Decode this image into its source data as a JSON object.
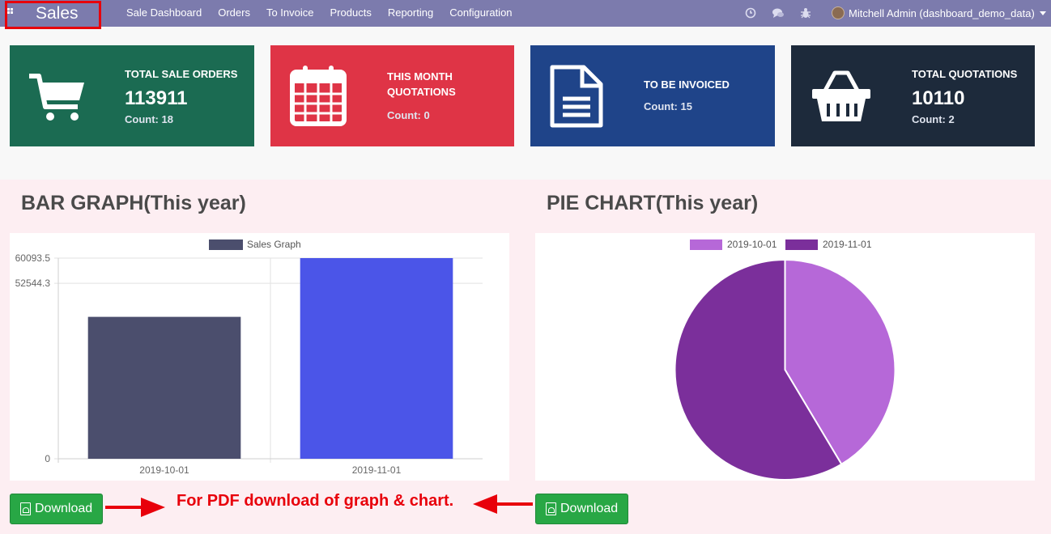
{
  "navbar": {
    "app_title": "Sales",
    "menu": [
      "Sale Dashboard",
      "Orders",
      "To Invoice",
      "Products",
      "Reporting",
      "Configuration"
    ],
    "user_name": "Mitchell Admin (dashboard_demo_data)",
    "icons": [
      "clock-icon",
      "chat-icon",
      "bug-icon"
    ]
  },
  "cards": [
    {
      "label": "TOTAL SALE ORDERS",
      "value": "113911",
      "count": "Count: 18",
      "color": "#1b6b52",
      "icon": "cart-icon"
    },
    {
      "label": "THIS MONTH QUOTATIONS",
      "count": "Count: 0",
      "color": "#df3446",
      "icon": "calendar-icon"
    },
    {
      "label": "TO BE INVOICED",
      "count": "Count: 15",
      "color": "#1f4489",
      "icon": "document-icon"
    },
    {
      "label": "TOTAL QUOTATIONS",
      "value": "10110",
      "count": "Count: 2",
      "color": "#1d2a3b",
      "icon": "basket-icon"
    }
  ],
  "bar_section": {
    "title": "BAR GRAPH(This year)",
    "download_label": "Download"
  },
  "pie_section": {
    "title": "PIE CHART(This year)",
    "download_label": "Download"
  },
  "note": "For PDF download of graph & chart.",
  "chart_data": [
    {
      "type": "bar",
      "legend": [
        "Sales Graph"
      ],
      "categories": [
        "2019-10-01",
        "2019-11-01"
      ],
      "series": [
        {
          "name": "Sales Graph",
          "values": [
            42500,
            60093.5
          ],
          "colors": [
            "#4b4e6d",
            "#4b55e8"
          ]
        }
      ],
      "yticks": [
        "60093.5",
        "52544.3",
        "0"
      ],
      "ylim": [
        0,
        60093.5
      ],
      "grid": true
    },
    {
      "type": "pie",
      "labels": [
        "2019-10-01",
        "2019-11-01"
      ],
      "values": [
        42500,
        60093.5
      ],
      "colors": [
        "#b668d8",
        "#7b2f9b"
      ],
      "legend": "top"
    }
  ]
}
